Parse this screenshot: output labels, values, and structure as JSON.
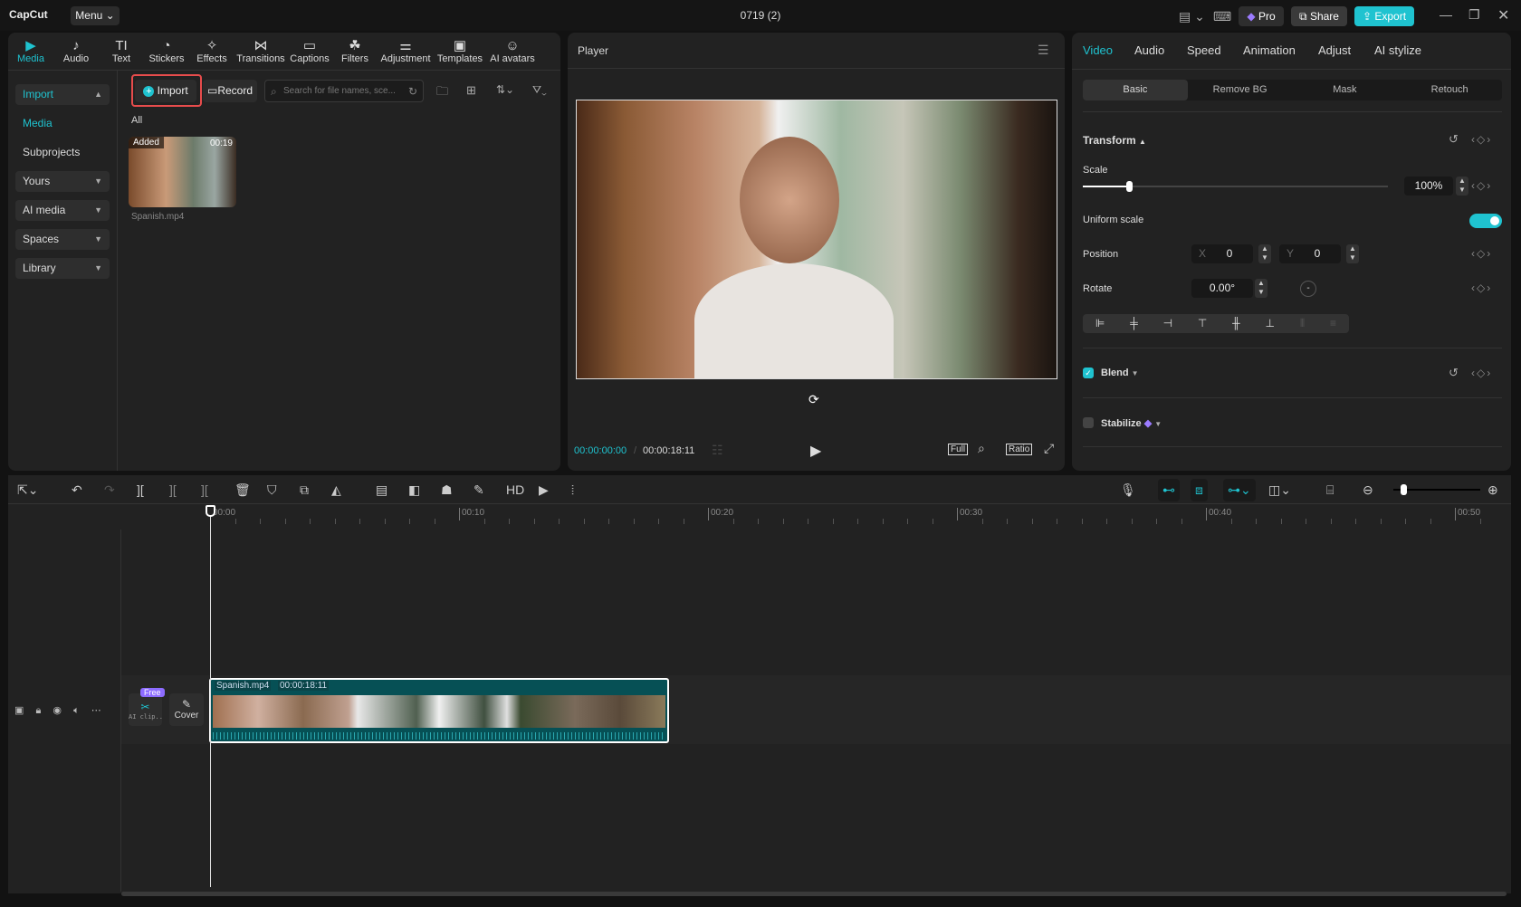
{
  "app": {
    "logo": "CapCut",
    "menu": "Menu",
    "title": "0719 (2)",
    "pro": "Pro",
    "share": "Share",
    "export": "Export",
    "accent": "#1fc3d0"
  },
  "tools": [
    {
      "label": "Media",
      "icon": "▶"
    },
    {
      "label": "Audio",
      "icon": "♪"
    },
    {
      "label": "Text",
      "icon": "TI"
    },
    {
      "label": "Stickers",
      "icon": "◔"
    },
    {
      "label": "Effects",
      "icon": "✧"
    },
    {
      "label": "Transitions",
      "icon": "⋈"
    },
    {
      "label": "Captions",
      "icon": "▭"
    },
    {
      "label": "Filters",
      "icon": "☘"
    },
    {
      "label": "Adjustment",
      "icon": "⚌"
    },
    {
      "label": "Templates",
      "icon": "▣"
    },
    {
      "label": "AI avatars",
      "icon": "☺"
    }
  ],
  "sidebar": {
    "import": "Import",
    "media": "Media",
    "subprojects": "Subprojects",
    "yours": "Yours",
    "ai_media": "AI media",
    "spaces": "Spaces",
    "library": "Library"
  },
  "media": {
    "import_btn": "Import",
    "record_btn": "Record",
    "search_placeholder": "Search for file names, sce...",
    "filter_all": "All",
    "clip": {
      "badge": "Added",
      "duration": "00:19",
      "name": "Spanish.mp4"
    }
  },
  "player": {
    "title": "Player",
    "current": "00:00:00:00",
    "total": "00:00:18:11",
    "full": "Full",
    "ratio": "Ratio"
  },
  "right": {
    "tabs": [
      "Video",
      "Audio",
      "Speed",
      "Animation",
      "Adjust",
      "AI stylize"
    ],
    "subtabs": [
      "Basic",
      "Remove BG",
      "Mask",
      "Retouch"
    ],
    "transform": "Transform",
    "scale_label": "Scale",
    "scale_value": "100%",
    "scale_fraction": 0.15,
    "uniform": "Uniform scale",
    "position": "Position",
    "x_label": "X",
    "x": "0",
    "y_label": "Y",
    "y": "0",
    "rotate": "Rotate",
    "rotate_value": "0.00°",
    "blend": "Blend",
    "stabilize": "Stabilize"
  },
  "timeline": {
    "ruler": [
      "00:00",
      "00:10",
      "00:20",
      "00:30",
      "00:40",
      "00:50"
    ],
    "clip_name": "Spanish.mp4",
    "clip_duration": "00:00:18:11",
    "free": "Free",
    "ai_clip": "AI clip...",
    "cover": "Cover"
  }
}
